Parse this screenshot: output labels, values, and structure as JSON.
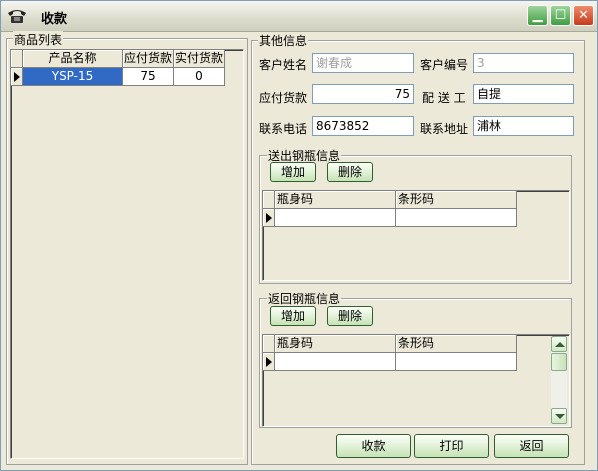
{
  "window": {
    "title": "收款"
  },
  "product_list": {
    "label": "商品列表",
    "columns": [
      "产品名称",
      "应付货款",
      "实付货款"
    ],
    "rows": [
      {
        "name": "YSP-15",
        "payable": "75",
        "paid": "0"
      }
    ]
  },
  "other_info": {
    "label": "其他信息",
    "customer_name_label": "客户姓名",
    "customer_name": "谢春成",
    "customer_no_label": "客户编号",
    "customer_no": "3",
    "payable_label": "应付货款",
    "payable": "75",
    "delivery_worker_label": "配 送 工",
    "delivery_worker": "自提",
    "phone_label": "联系电话",
    "phone": "8673852",
    "address_label": "联系地址",
    "address": "浦林"
  },
  "outgoing_cylinders": {
    "label": "送出钢瓶信息",
    "add_label": "增加",
    "delete_label": "删除",
    "columns": [
      "瓶身码",
      "条形码"
    ]
  },
  "returned_cylinders": {
    "label": "返回钢瓶信息",
    "add_label": "增加",
    "delete_label": "删除",
    "columns": [
      "瓶身码",
      "条形码"
    ]
  },
  "actions": {
    "collect_label": "收款",
    "print_label": "打印",
    "back_label": "返回"
  },
  "icons": [
    "phone-icon",
    "minimize-icon",
    "maximize-icon",
    "close-icon",
    "row-pointer-icon",
    "scroll-up-icon",
    "scroll-down-icon"
  ]
}
